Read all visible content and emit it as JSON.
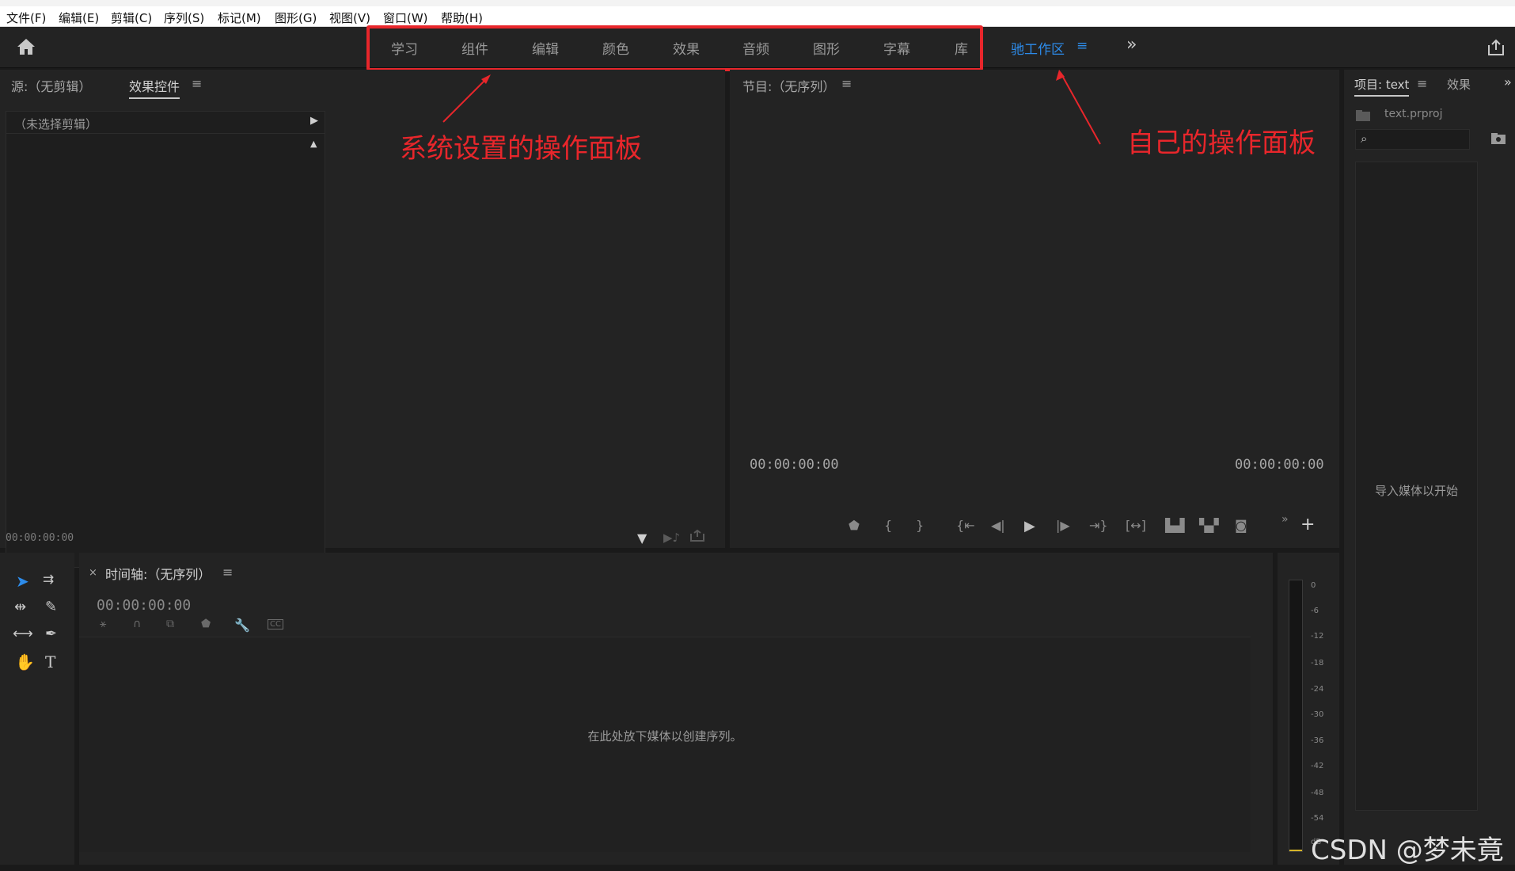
{
  "menubar": {
    "items": [
      "文件(F)",
      "编辑(E)",
      "剪辑(C)",
      "序列(S)",
      "标记(M)",
      "图形(G)",
      "视图(V)",
      "窗口(W)",
      "帮助(H)"
    ]
  },
  "header": {
    "workspace_tabs": [
      "学习",
      "组件",
      "编辑",
      "颜色",
      "效果",
      "音频",
      "图形",
      "字幕",
      "库"
    ],
    "custom_workspace": "驰工作区",
    "more_label": "»"
  },
  "source_panel": {
    "tab_source": "源:（无剪辑）",
    "tab_effect_controls": "效果控件",
    "no_clip": "（未选择剪辑）",
    "timecode": "00:00:00:00"
  },
  "program_panel": {
    "title": "节目:（无序列）",
    "timecode_left": "00:00:00:00",
    "timecode_right": "00:00:00:00"
  },
  "project_panel": {
    "tab_project": "项目: text",
    "tab_effects": "效果",
    "file_name": "text.prproj",
    "empty_text": "导入媒体以开始"
  },
  "timeline_panel": {
    "close": "×",
    "title": "时间轴:（无序列）",
    "timecode": "00:00:00:00",
    "drop_hint": "在此处放下媒体以创建序列。"
  },
  "audio_meter": {
    "scale": [
      "0",
      "-6",
      "-12",
      "-18",
      "-24",
      "-30",
      "-36",
      "-42",
      "-48",
      "-54",
      "dB"
    ]
  },
  "annotations": {
    "system": "系统设置的操作面板",
    "custom": "自己的操作面板",
    "color": "#e8262b"
  },
  "watermark": "CSDN @梦未竟",
  "colors": {
    "accent": "#2d8ceb",
    "panel_bg": "#232323",
    "annotation": "#e8262b"
  }
}
